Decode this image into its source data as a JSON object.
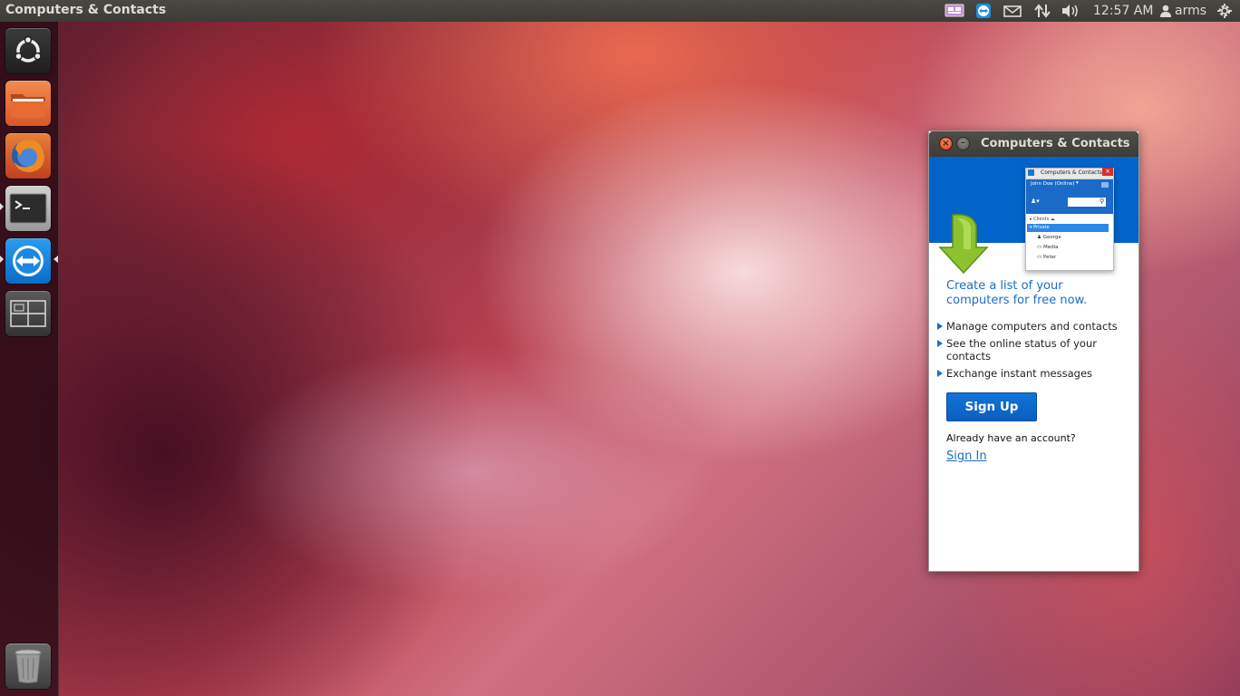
{
  "top_panel": {
    "app_title": "Computers & Contacts",
    "clock": "12:57 AM",
    "user": "arms",
    "tray_icons": [
      "indicator-icon",
      "teamviewer-icon",
      "mail-icon",
      "network-icon",
      "volume-icon",
      "session-gear-icon"
    ]
  },
  "launcher": {
    "items": [
      {
        "name": "dash-home-icon"
      },
      {
        "name": "files-icon"
      },
      {
        "name": "firefox-icon"
      },
      {
        "name": "terminal-icon"
      },
      {
        "name": "teamviewer-icon"
      },
      {
        "name": "workspace-switcher-icon"
      },
      {
        "name": "trash-icon"
      }
    ]
  },
  "window": {
    "title": "Computers & Contacts",
    "preview": {
      "title": "Computers & Contacts",
      "user": "John Doe (Online)",
      "groups": [
        "Clients",
        "Private"
      ],
      "contacts": [
        "George",
        "Media",
        "Peter"
      ]
    },
    "headline": "Create a list of your computers for free now.",
    "bullets": [
      "Manage computers and contacts",
      "See the online status of your contacts",
      "Exchange instant messages"
    ],
    "signup_label": "Sign Up",
    "account_question": "Already have an account?",
    "signin_label": "Sign In"
  },
  "colors": {
    "accent_blue": "#0263c8",
    "link_blue": "#1b6ec2",
    "panel": "#3c3b37",
    "close_orange": "#e0562d"
  }
}
